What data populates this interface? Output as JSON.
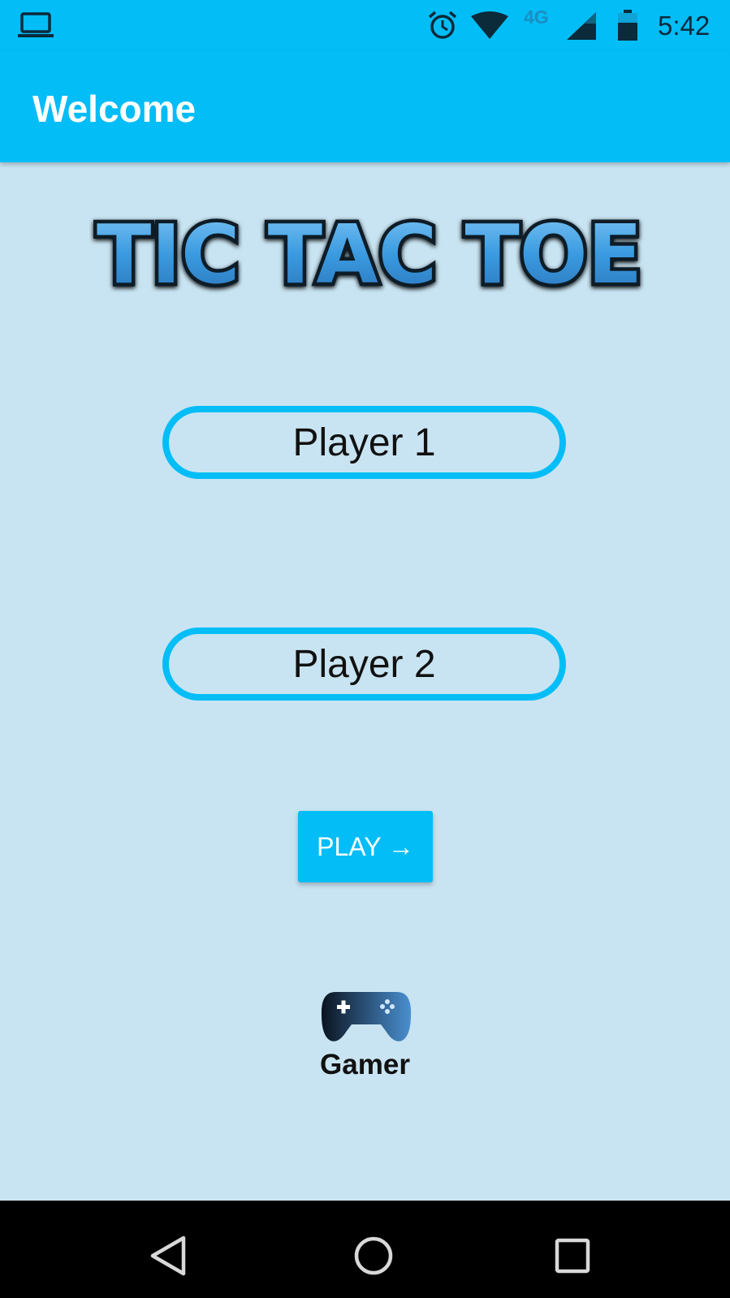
{
  "status_bar": {
    "left_icon": "laptop-icon",
    "network_type": "4G",
    "time": "5:42",
    "icons": [
      "alarm-icon",
      "wifi-icon",
      "signal-icon",
      "battery-icon"
    ]
  },
  "app_bar": {
    "title": "Welcome",
    "color": "#03bdf7"
  },
  "logo": {
    "text": "TIC TAC TOE"
  },
  "form": {
    "player1_value": "Player 1",
    "player2_value": "Player 2",
    "play_label": "PLAY →"
  },
  "footer": {
    "icon": "gamepad-icon",
    "label": "Gamer"
  },
  "nav_bar": {
    "icons": [
      "back-icon",
      "home-icon",
      "recents-icon"
    ]
  },
  "colors": {
    "accent": "#03bdf7",
    "background": "#c8e4f2",
    "text": "#111111"
  }
}
